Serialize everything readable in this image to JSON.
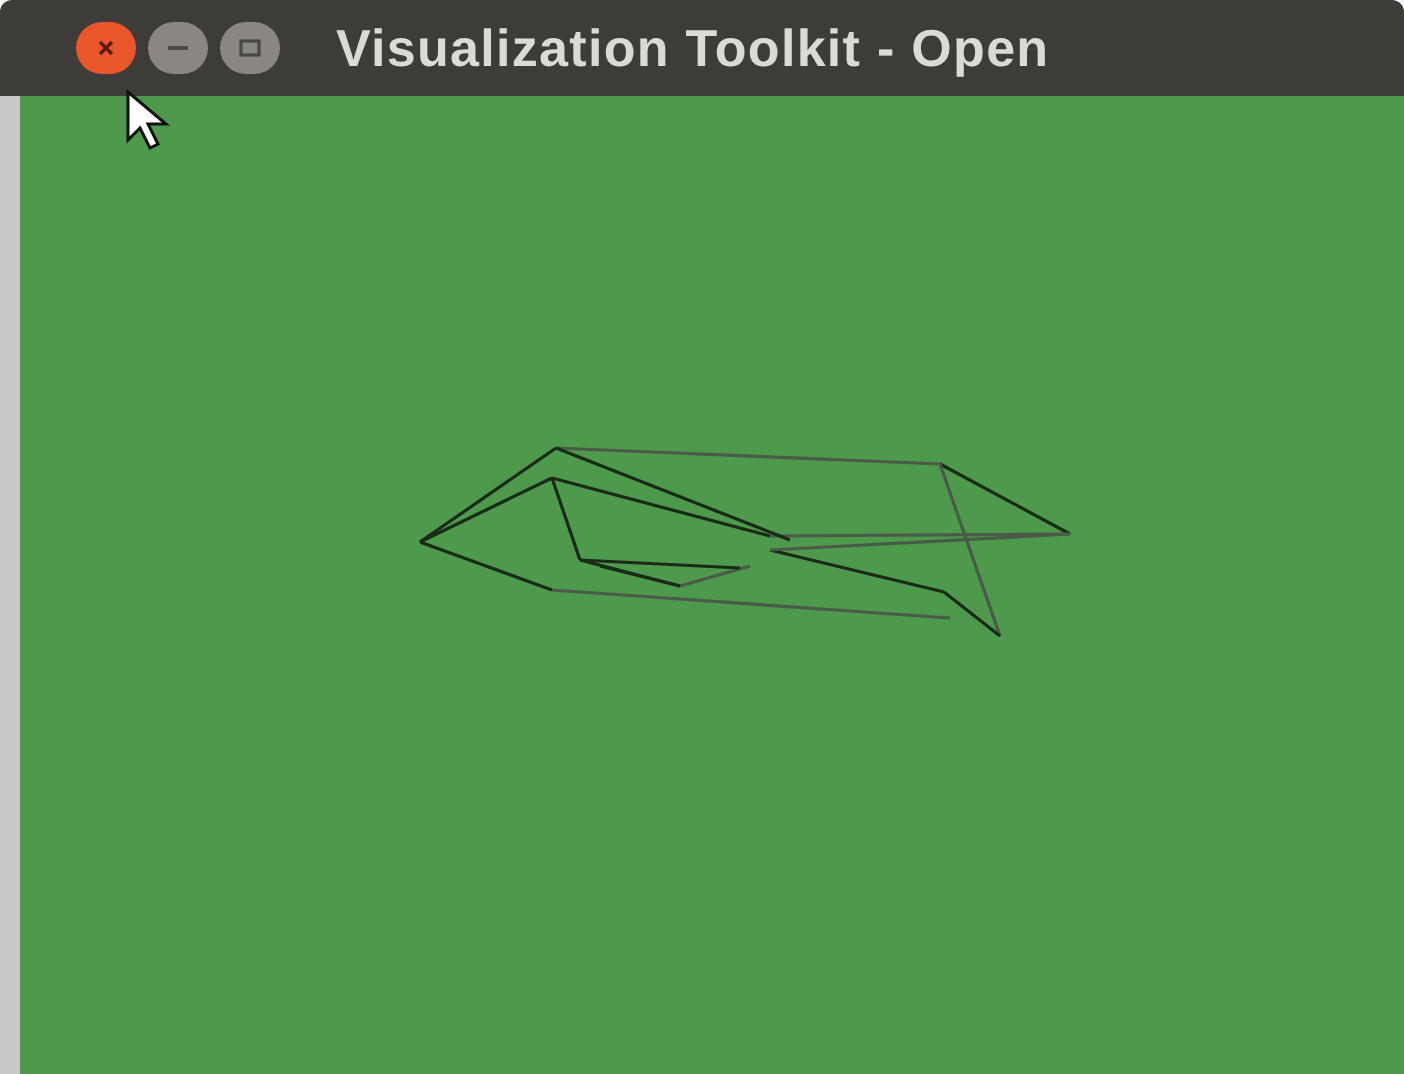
{
  "window": {
    "title": "Visualization Toolkit - Open"
  }
}
